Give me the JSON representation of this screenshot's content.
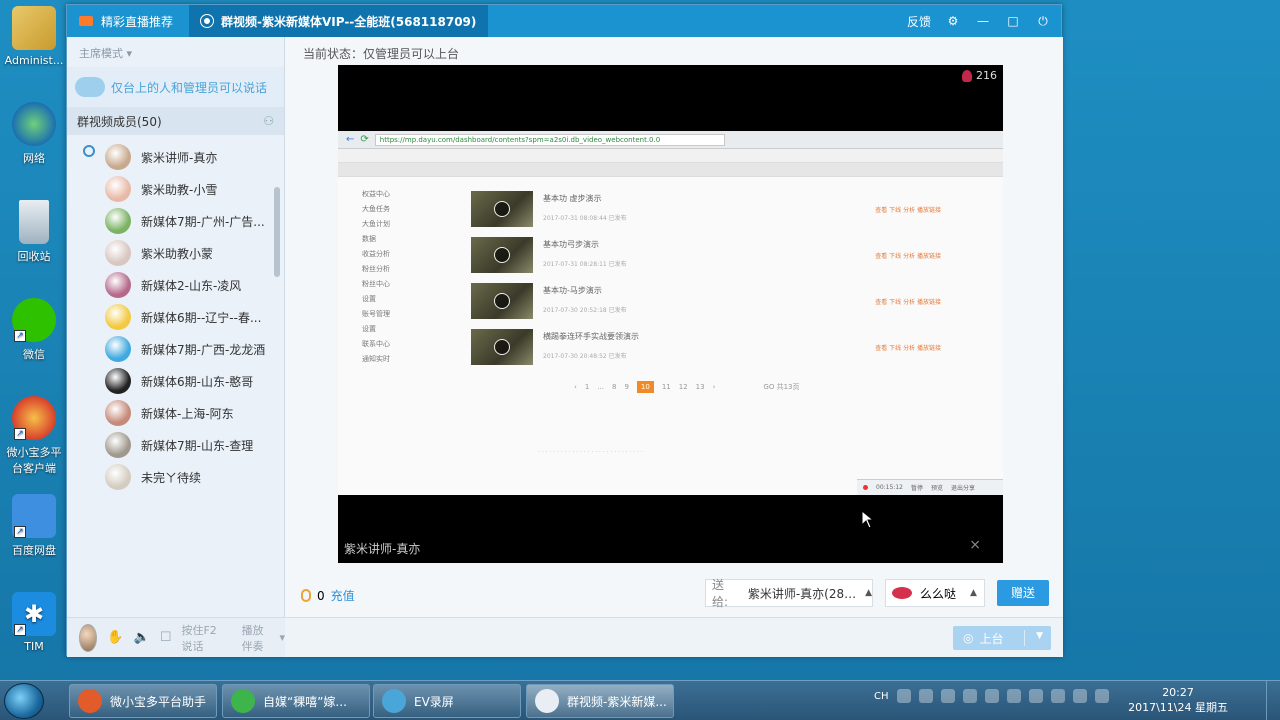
{
  "desktop": {
    "icons": [
      {
        "label": "Administ...",
        "icon": "user-folder-icon"
      },
      {
        "label": "网络",
        "icon": "network-icon"
      },
      {
        "label": "回收站",
        "icon": "recycle-bin-icon"
      },
      {
        "label": "微信",
        "icon": "wechat-icon"
      },
      {
        "label": "微小宝多平台客户端",
        "icon": "weixiaobao-icon"
      },
      {
        "label": "百度网盘",
        "icon": "baidu-netdisk-icon"
      },
      {
        "label": "TIM",
        "icon": "tim-icon"
      }
    ]
  },
  "window": {
    "tab_live": "精彩直播推荐",
    "tab_active": "群视频-紫米新媒体VIP--全能班(568118709)",
    "feedback": "反馈"
  },
  "left": {
    "mode": "主席模式 ▾",
    "notice": "仅台上的人和管理员可以说话",
    "members_header": "群视频成员(50)",
    "members": [
      {
        "name": "紫米讲师-真亦",
        "color": "#c9a98e"
      },
      {
        "name": "紫米助教-小雪",
        "color": "#e9b9a8"
      },
      {
        "name": "新媒体7期-广州-广告...",
        "color": "#7bb364"
      },
      {
        "name": "紫米助教小蒙",
        "color": "#d8c6c0"
      },
      {
        "name": "新媒体2-山东-凌风",
        "color": "#b56a8a"
      },
      {
        "name": "新媒体6期--辽宁--春...",
        "color": "#f2c940"
      },
      {
        "name": "新媒体7期-广西-龙龙酒",
        "color": "#3fa9e0"
      },
      {
        "name": "新媒体6期-山东-憨哥",
        "color": "#222222"
      },
      {
        "name": "新媒体-上海-阿东",
        "color": "#c58a7a"
      },
      {
        "name": "新媒体7期-山东-查理",
        "color": "#a0988c"
      },
      {
        "name": "未完ㄚ待续",
        "color": "#d4ccc0"
      }
    ],
    "hold_to_talk": "按住F2说话",
    "bg_music": "播放伴奏"
  },
  "main": {
    "status": "当前状态：仅管理员可以上台",
    "viewers": "216",
    "video_caption": "紫米讲师-真亦",
    "shared_screen": {
      "url": "https://mp.dayu.com/dashboard/contents?spm=a2s0i.db_video_webcontent.0.0",
      "menu": [
        "权益中心",
        "大鱼任务",
        "大鱼计划",
        "数据",
        "收益分析",
        "粉丝分析",
        "粉丝中心",
        "设置",
        "账号管理",
        "设置",
        "联系中心",
        "通知实时"
      ],
      "videos": [
        {
          "title": "基本功 虚步演示",
          "meta": "2017-07-31 08:08:44   已发布"
        },
        {
          "title": "基本功弓步演示",
          "meta": "2017-07-31 08:28:11   已发布"
        },
        {
          "title": "基本功-马步演示",
          "meta": "2017-07-30 20:52:18   已发布"
        },
        {
          "title": "横踢拳连环手实战要领演示",
          "meta": "2017-07-30 20:48:52   已发布"
        }
      ],
      "actions": "查看  下线  分析  播放链接",
      "pages": [
        "‹",
        "1",
        "...",
        "8",
        "9",
        "10",
        "11",
        "12",
        "13",
        "›"
      ],
      "current_page": "10",
      "goto": "GO  共13页",
      "rec_time": "00:15:12",
      "rec_buttons": [
        "暂停",
        "预览",
        "退出分享"
      ]
    },
    "coins": "0",
    "recharge": "充值",
    "send_to_label": "送给:",
    "send_to_value": "紫米讲师-真亦(2805...",
    "gift": "么么哒",
    "send_button": "赠送",
    "stage_button": "上台"
  },
  "taskbar": {
    "tasks": [
      {
        "label": "微小宝多平台助手",
        "color": "#e25b2a"
      },
      {
        "label": "自媒“稞嘻”嫁...",
        "color": "#3db54a"
      },
      {
        "label": "EV录屏",
        "color": "#4aa6d8"
      },
      {
        "label": "群视频-紫米新媒...",
        "color": "#e8eef4"
      }
    ],
    "lang": "CH",
    "time": "20:27",
    "date": "2017\\11\\24 星期五"
  }
}
